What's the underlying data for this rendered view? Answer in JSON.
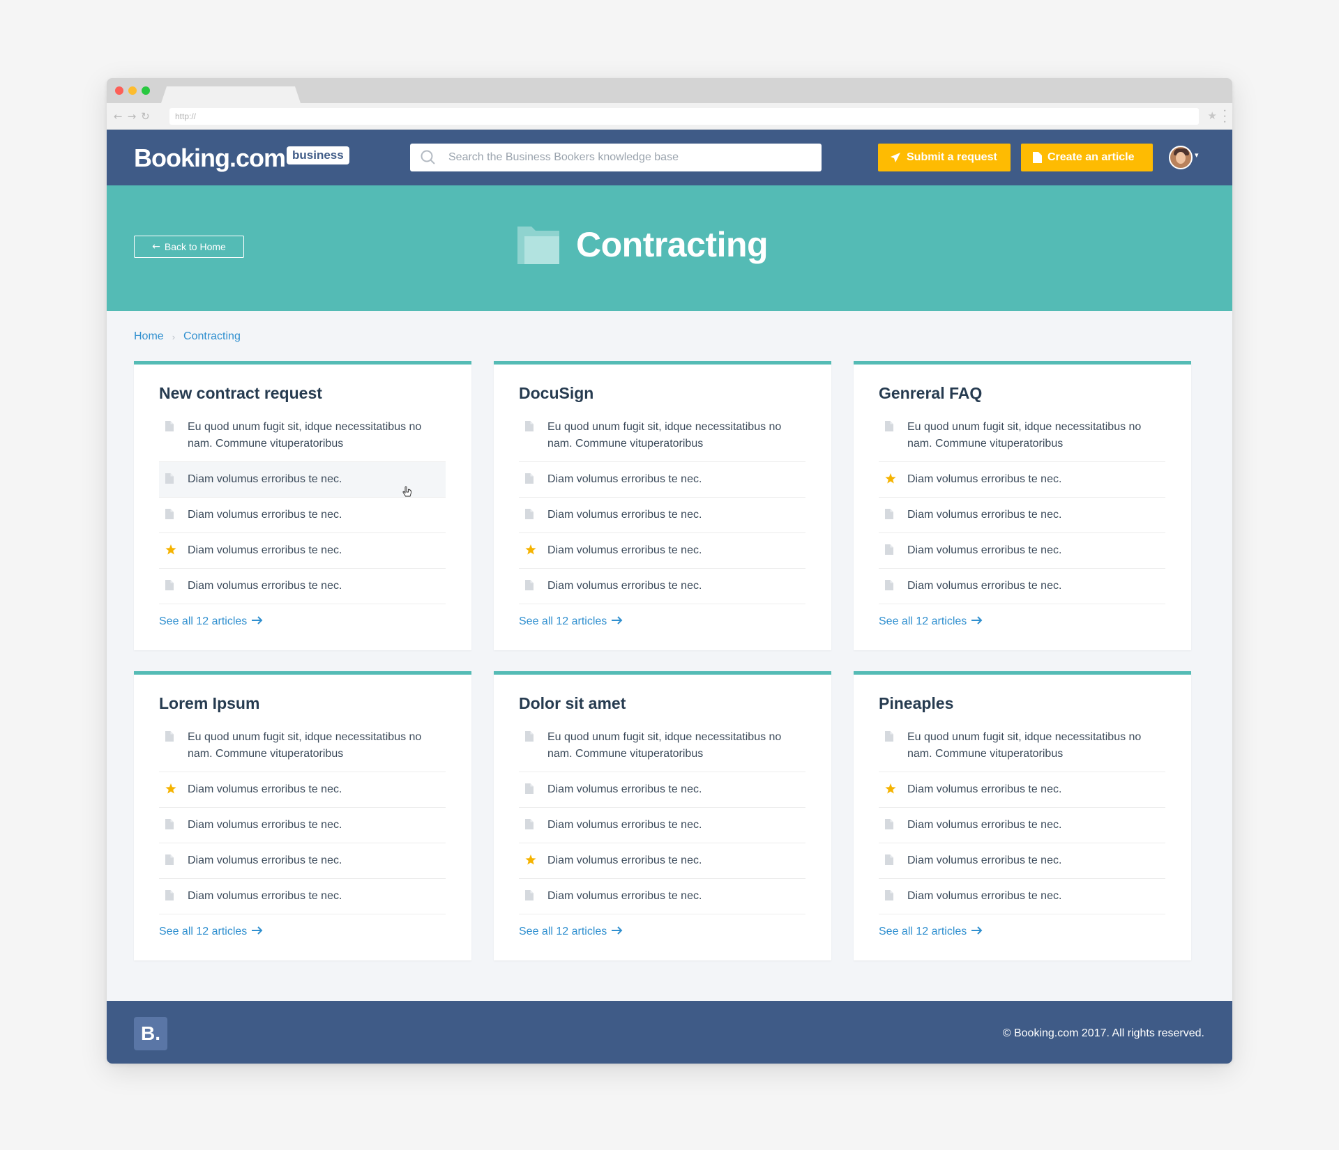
{
  "browser": {
    "url": "http://"
  },
  "header": {
    "logo": "Booking.com",
    "logo_badge": "business",
    "search_placeholder": "Search the Business Bookers knowledge base",
    "submit_label": "Submit a request",
    "create_label": "Create an article"
  },
  "banner": {
    "back_label": "Back to Home",
    "title": "Contracting"
  },
  "breadcrumb": {
    "home": "Home",
    "current": "Contracting"
  },
  "cards": [
    {
      "title": "New contract request",
      "items": [
        {
          "text": "Eu quod unum fugit sit, idque necessitatibus no nam. Commune vituperatoribus",
          "icon": "document-icon"
        },
        {
          "text": "Diam volumus erroribus te nec.",
          "icon": "document-icon"
        },
        {
          "text": "Diam volumus erroribus te nec.",
          "icon": "document-icon"
        },
        {
          "text": "Diam volumus erroribus te nec.",
          "icon": "star-icon"
        },
        {
          "text": "Diam volumus erroribus te nec.",
          "icon": "document-icon"
        }
      ],
      "more": "See all 12 articles"
    },
    {
      "title": "DocuSign",
      "items": [
        {
          "text": "Eu quod unum fugit sit, idque necessitatibus no nam. Commune vituperatoribus",
          "icon": "document-icon"
        },
        {
          "text": "Diam volumus erroribus te nec.",
          "icon": "document-icon"
        },
        {
          "text": "Diam volumus erroribus te nec.",
          "icon": "document-icon"
        },
        {
          "text": "Diam volumus erroribus te nec.",
          "icon": "star-icon"
        },
        {
          "text": "Diam volumus erroribus te nec.",
          "icon": "document-icon"
        }
      ],
      "more": "See all 12 articles"
    },
    {
      "title": "Genreral FAQ",
      "items": [
        {
          "text": "Eu quod unum fugit sit, idque necessitatibus no nam. Commune vituperatoribus",
          "icon": "document-icon"
        },
        {
          "text": "Diam volumus erroribus te nec.",
          "icon": "star-icon"
        },
        {
          "text": "Diam volumus erroribus te nec.",
          "icon": "document-icon"
        },
        {
          "text": "Diam volumus erroribus te nec.",
          "icon": "document-icon"
        },
        {
          "text": "Diam volumus erroribus te nec.",
          "icon": "document-icon"
        }
      ],
      "more": "See all 12 articles"
    },
    {
      "title": "Lorem Ipsum",
      "items": [
        {
          "text": "Eu quod unum fugit sit, idque necessitatibus no nam. Commune vituperatoribus",
          "icon": "document-icon"
        },
        {
          "text": "Diam volumus erroribus te nec.",
          "icon": "star-icon"
        },
        {
          "text": "Diam volumus erroribus te nec.",
          "icon": "document-icon"
        },
        {
          "text": "Diam volumus erroribus te nec.",
          "icon": "document-icon"
        },
        {
          "text": "Diam volumus erroribus te nec.",
          "icon": "document-icon"
        }
      ],
      "more": "See all 12 articles"
    },
    {
      "title": "Dolor sit amet",
      "items": [
        {
          "text": "Eu quod unum fugit sit, idque necessitatibus no nam. Commune vituperatoribus",
          "icon": "document-icon"
        },
        {
          "text": "Diam volumus erroribus te nec.",
          "icon": "document-icon"
        },
        {
          "text": "Diam volumus erroribus te nec.",
          "icon": "document-icon"
        },
        {
          "text": "Diam volumus erroribus te nec.",
          "icon": "star-icon"
        },
        {
          "text": "Diam volumus erroribus te nec.",
          "icon": "document-icon"
        }
      ],
      "more": "See all 12 articles"
    },
    {
      "title": "Pineaples",
      "items": [
        {
          "text": "Eu quod unum fugit sit, idque necessitatibus no nam. Commune vituperatoribus",
          "icon": "document-icon"
        },
        {
          "text": "Diam volumus erroribus te nec.",
          "icon": "star-icon"
        },
        {
          "text": "Diam volumus erroribus te nec.",
          "icon": "document-icon"
        },
        {
          "text": "Diam volumus erroribus te nec.",
          "icon": "document-icon"
        },
        {
          "text": "Diam volumus erroribus te nec.",
          "icon": "document-icon"
        }
      ],
      "more": "See all 12 articles"
    }
  ],
  "footer": {
    "logo": "B.",
    "copyright": "© Booking.com 2017. All rights reserved."
  },
  "colors": {
    "header": "#3f5b87",
    "banner": "#54bbb5",
    "accent_yellow": "#febb02",
    "link": "#2f8fcf",
    "star": "#f5b301"
  }
}
